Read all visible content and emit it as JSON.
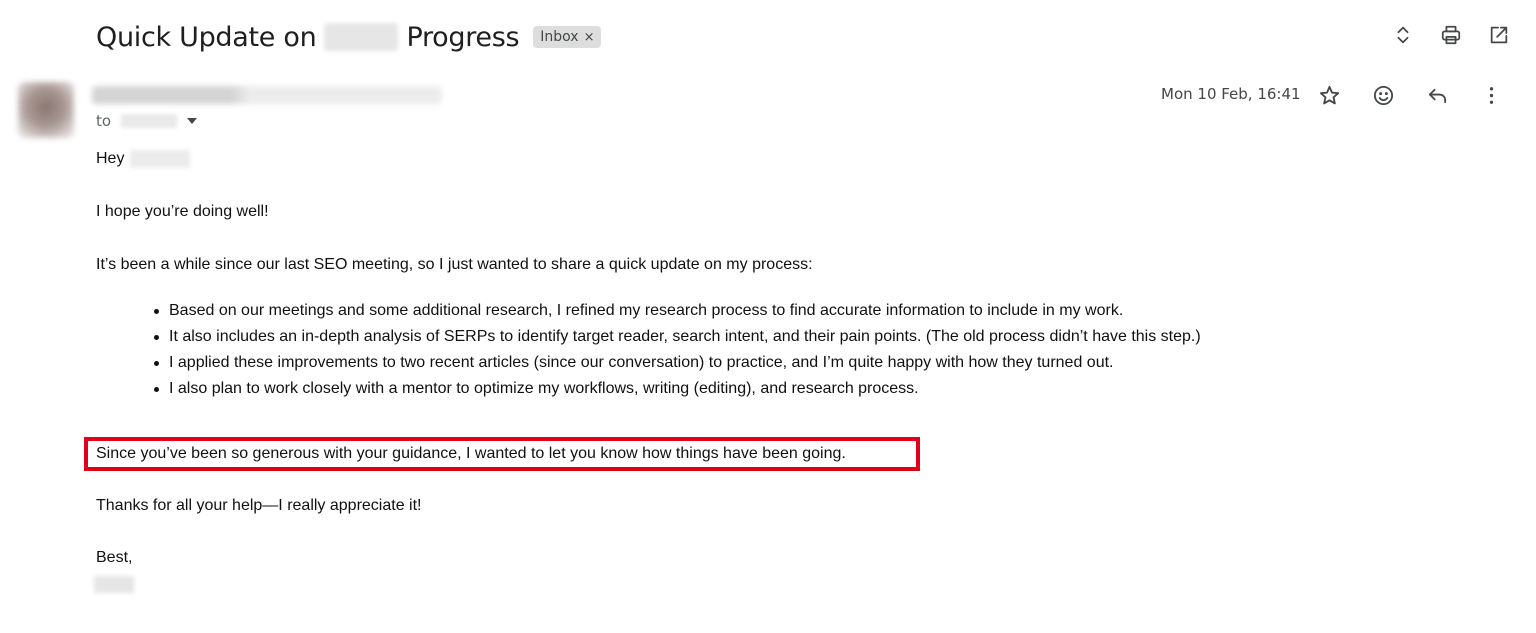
{
  "subject": {
    "prefix": "Quick Update on",
    "suffix": "Progress",
    "label": "Inbox",
    "label_close": "×"
  },
  "toolbar_icons": [
    "unfold-icon",
    "print-icon",
    "open-in-new-window-icon"
  ],
  "message": {
    "to_label": "to",
    "date": "Mon 10 Feb, 16:41",
    "action_icons": [
      "star-icon",
      "emoji-icon",
      "reply-icon",
      "more-vert-icon"
    ]
  },
  "body": {
    "greeting": "Hey",
    "intro": "I hope you’re doing well!",
    "lead": "It’s been a while since our last SEO meeting, so I just wanted to share a quick update on my process:",
    "bullets": [
      "Based on our meetings and some additional research, I refined my research process to find accurate information to include in my work.",
      "It also includes an in-depth analysis of SERPs to identify target reader, search intent, and their pain points. (The old process didn’t have this step.)",
      "I applied these improvements to two recent articles (since our conversation) to practice, and I’m quite happy with how they turned out.",
      "I also plan to work closely with a mentor to optimize my workflows, writing (editing), and research process."
    ],
    "highlighted": "Since you’ve been so generous with your guidance, I wanted to let you know how things have been going.",
    "thanks": "Thanks for all your help—I really appreciate it!",
    "signoff": "Best,"
  },
  "colors": {
    "highlight_border": "#e0001b",
    "text": "#111111",
    "label_chip": "#dddddd"
  }
}
